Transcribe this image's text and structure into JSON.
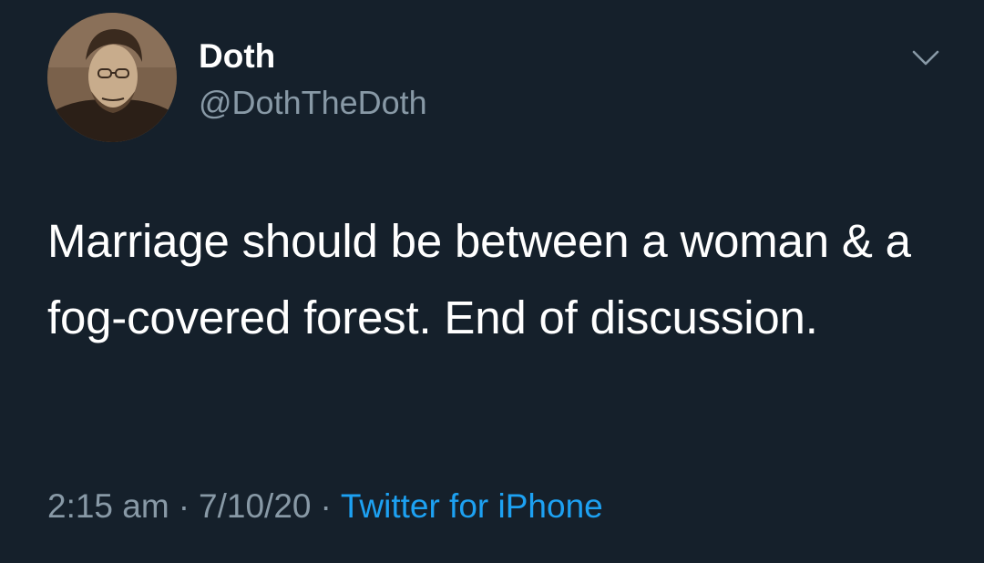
{
  "tweet": {
    "author": {
      "display_name": "Doth",
      "handle": "@DothTheDoth",
      "avatar": "portrait-avatar"
    },
    "menu_icon": "chevron-down-icon",
    "text": "Marriage should be between a woman & a fog-covered forest. End of discussion.",
    "meta": {
      "time": "2:15 am",
      "date": "7/10/20",
      "separator": "·",
      "source": "Twitter for iPhone"
    }
  },
  "colors": {
    "background": "#15202b",
    "primary_text": "#ffffff",
    "secondary_text": "#8899a6",
    "link": "#1da1f2"
  }
}
